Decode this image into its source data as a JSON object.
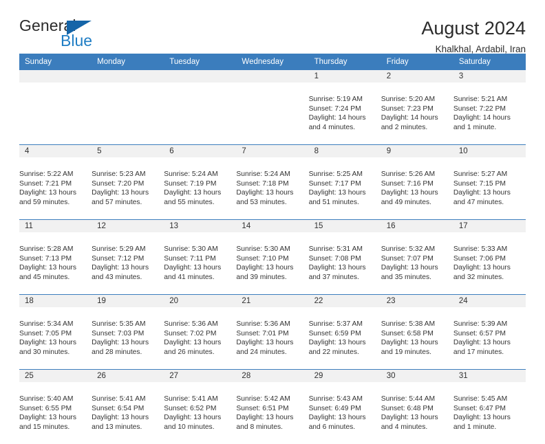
{
  "brand": {
    "name_part1": "General",
    "name_part2": "Blue"
  },
  "header": {
    "title": "August 2024",
    "location": "Khalkhal, Ardabil, Iran"
  },
  "calendar": {
    "weekday_headers": [
      "Sunday",
      "Monday",
      "Tuesday",
      "Wednesday",
      "Thursday",
      "Friday",
      "Saturday"
    ],
    "accent_color": "#3b7dbd",
    "daynum_band_color": "#f1f1f1",
    "weeks": [
      [
        {
          "day": "",
          "sunrise": "",
          "sunset": "",
          "daylight1": "",
          "daylight2": ""
        },
        {
          "day": "",
          "sunrise": "",
          "sunset": "",
          "daylight1": "",
          "daylight2": ""
        },
        {
          "day": "",
          "sunrise": "",
          "sunset": "",
          "daylight1": "",
          "daylight2": ""
        },
        {
          "day": "",
          "sunrise": "",
          "sunset": "",
          "daylight1": "",
          "daylight2": ""
        },
        {
          "day": "1",
          "sunrise": "Sunrise: 5:19 AM",
          "sunset": "Sunset: 7:24 PM",
          "daylight1": "Daylight: 14 hours",
          "daylight2": "and 4 minutes."
        },
        {
          "day": "2",
          "sunrise": "Sunrise: 5:20 AM",
          "sunset": "Sunset: 7:23 PM",
          "daylight1": "Daylight: 14 hours",
          "daylight2": "and 2 minutes."
        },
        {
          "day": "3",
          "sunrise": "Sunrise: 5:21 AM",
          "sunset": "Sunset: 7:22 PM",
          "daylight1": "Daylight: 14 hours",
          "daylight2": "and 1 minute."
        }
      ],
      [
        {
          "day": "4",
          "sunrise": "Sunrise: 5:22 AM",
          "sunset": "Sunset: 7:21 PM",
          "daylight1": "Daylight: 13 hours",
          "daylight2": "and 59 minutes."
        },
        {
          "day": "5",
          "sunrise": "Sunrise: 5:23 AM",
          "sunset": "Sunset: 7:20 PM",
          "daylight1": "Daylight: 13 hours",
          "daylight2": "and 57 minutes."
        },
        {
          "day": "6",
          "sunrise": "Sunrise: 5:24 AM",
          "sunset": "Sunset: 7:19 PM",
          "daylight1": "Daylight: 13 hours",
          "daylight2": "and 55 minutes."
        },
        {
          "day": "7",
          "sunrise": "Sunrise: 5:24 AM",
          "sunset": "Sunset: 7:18 PM",
          "daylight1": "Daylight: 13 hours",
          "daylight2": "and 53 minutes."
        },
        {
          "day": "8",
          "sunrise": "Sunrise: 5:25 AM",
          "sunset": "Sunset: 7:17 PM",
          "daylight1": "Daylight: 13 hours",
          "daylight2": "and 51 minutes."
        },
        {
          "day": "9",
          "sunrise": "Sunrise: 5:26 AM",
          "sunset": "Sunset: 7:16 PM",
          "daylight1": "Daylight: 13 hours",
          "daylight2": "and 49 minutes."
        },
        {
          "day": "10",
          "sunrise": "Sunrise: 5:27 AM",
          "sunset": "Sunset: 7:15 PM",
          "daylight1": "Daylight: 13 hours",
          "daylight2": "and 47 minutes."
        }
      ],
      [
        {
          "day": "11",
          "sunrise": "Sunrise: 5:28 AM",
          "sunset": "Sunset: 7:13 PM",
          "daylight1": "Daylight: 13 hours",
          "daylight2": "and 45 minutes."
        },
        {
          "day": "12",
          "sunrise": "Sunrise: 5:29 AM",
          "sunset": "Sunset: 7:12 PM",
          "daylight1": "Daylight: 13 hours",
          "daylight2": "and 43 minutes."
        },
        {
          "day": "13",
          "sunrise": "Sunrise: 5:30 AM",
          "sunset": "Sunset: 7:11 PM",
          "daylight1": "Daylight: 13 hours",
          "daylight2": "and 41 minutes."
        },
        {
          "day": "14",
          "sunrise": "Sunrise: 5:30 AM",
          "sunset": "Sunset: 7:10 PM",
          "daylight1": "Daylight: 13 hours",
          "daylight2": "and 39 minutes."
        },
        {
          "day": "15",
          "sunrise": "Sunrise: 5:31 AM",
          "sunset": "Sunset: 7:08 PM",
          "daylight1": "Daylight: 13 hours",
          "daylight2": "and 37 minutes."
        },
        {
          "day": "16",
          "sunrise": "Sunrise: 5:32 AM",
          "sunset": "Sunset: 7:07 PM",
          "daylight1": "Daylight: 13 hours",
          "daylight2": "and 35 minutes."
        },
        {
          "day": "17",
          "sunrise": "Sunrise: 5:33 AM",
          "sunset": "Sunset: 7:06 PM",
          "daylight1": "Daylight: 13 hours",
          "daylight2": "and 32 minutes."
        }
      ],
      [
        {
          "day": "18",
          "sunrise": "Sunrise: 5:34 AM",
          "sunset": "Sunset: 7:05 PM",
          "daylight1": "Daylight: 13 hours",
          "daylight2": "and 30 minutes."
        },
        {
          "day": "19",
          "sunrise": "Sunrise: 5:35 AM",
          "sunset": "Sunset: 7:03 PM",
          "daylight1": "Daylight: 13 hours",
          "daylight2": "and 28 minutes."
        },
        {
          "day": "20",
          "sunrise": "Sunrise: 5:36 AM",
          "sunset": "Sunset: 7:02 PM",
          "daylight1": "Daylight: 13 hours",
          "daylight2": "and 26 minutes."
        },
        {
          "day": "21",
          "sunrise": "Sunrise: 5:36 AM",
          "sunset": "Sunset: 7:01 PM",
          "daylight1": "Daylight: 13 hours",
          "daylight2": "and 24 minutes."
        },
        {
          "day": "22",
          "sunrise": "Sunrise: 5:37 AM",
          "sunset": "Sunset: 6:59 PM",
          "daylight1": "Daylight: 13 hours",
          "daylight2": "and 22 minutes."
        },
        {
          "day": "23",
          "sunrise": "Sunrise: 5:38 AM",
          "sunset": "Sunset: 6:58 PM",
          "daylight1": "Daylight: 13 hours",
          "daylight2": "and 19 minutes."
        },
        {
          "day": "24",
          "sunrise": "Sunrise: 5:39 AM",
          "sunset": "Sunset: 6:57 PM",
          "daylight1": "Daylight: 13 hours",
          "daylight2": "and 17 minutes."
        }
      ],
      [
        {
          "day": "25",
          "sunrise": "Sunrise: 5:40 AM",
          "sunset": "Sunset: 6:55 PM",
          "daylight1": "Daylight: 13 hours",
          "daylight2": "and 15 minutes."
        },
        {
          "day": "26",
          "sunrise": "Sunrise: 5:41 AM",
          "sunset": "Sunset: 6:54 PM",
          "daylight1": "Daylight: 13 hours",
          "daylight2": "and 13 minutes."
        },
        {
          "day": "27",
          "sunrise": "Sunrise: 5:41 AM",
          "sunset": "Sunset: 6:52 PM",
          "daylight1": "Daylight: 13 hours",
          "daylight2": "and 10 minutes."
        },
        {
          "day": "28",
          "sunrise": "Sunrise: 5:42 AM",
          "sunset": "Sunset: 6:51 PM",
          "daylight1": "Daylight: 13 hours",
          "daylight2": "and 8 minutes."
        },
        {
          "day": "29",
          "sunrise": "Sunrise: 5:43 AM",
          "sunset": "Sunset: 6:49 PM",
          "daylight1": "Daylight: 13 hours",
          "daylight2": "and 6 minutes."
        },
        {
          "day": "30",
          "sunrise": "Sunrise: 5:44 AM",
          "sunset": "Sunset: 6:48 PM",
          "daylight1": "Daylight: 13 hours",
          "daylight2": "and 4 minutes."
        },
        {
          "day": "31",
          "sunrise": "Sunrise: 5:45 AM",
          "sunset": "Sunset: 6:47 PM",
          "daylight1": "Daylight: 13 hours",
          "daylight2": "and 1 minute."
        }
      ]
    ]
  }
}
